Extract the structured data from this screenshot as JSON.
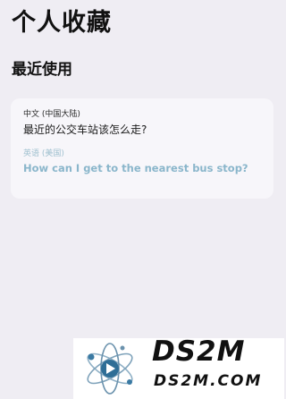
{
  "header": {
    "title": "个人收藏"
  },
  "recent": {
    "section_title": "最近使用",
    "items": [
      {
        "source_language": "中文 (中国大陆)",
        "source_text": "最近的公交车站该怎么走?",
        "target_language": "英语 (美国)",
        "target_text": "How can I get to the nearest bus stop?"
      }
    ]
  },
  "watermark": {
    "brand": "DS2M",
    "domain": "DS2M.COM"
  },
  "colors": {
    "background": "#efedf3",
    "card": "#f7f6fa",
    "translation_accent": "#8ab6cb"
  }
}
